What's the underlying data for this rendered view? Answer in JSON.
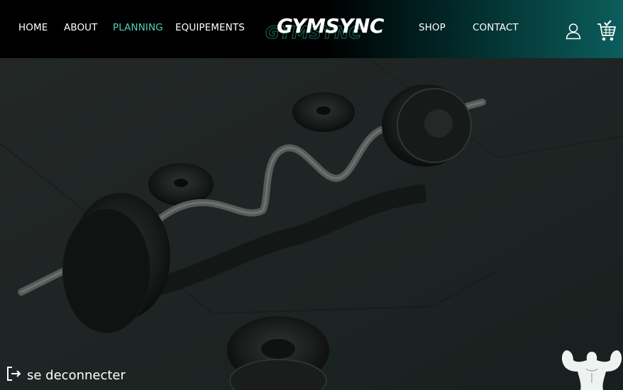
{
  "nav": {
    "left_links": [
      {
        "label": "HOME"
      },
      {
        "label": "ABOUT"
      },
      {
        "label": "PLANNING",
        "active": true
      },
      {
        "label": "EQUIPEMENTS"
      }
    ],
    "right_links": [
      {
        "label": "SHOP"
      },
      {
        "label": "CONTACT"
      }
    ],
    "logo": "GYMSYNC",
    "icons": [
      "user-icon",
      "shopping-cart-icon"
    ]
  },
  "footer": {
    "logout_label": "se deconnecter",
    "logout_icon": "logout-icon",
    "mascot_icon": "bodybuilder-icon"
  },
  "colors": {
    "accent": "#4fd1b4",
    "nav_bg": "#000000",
    "nav_gradient_end": "#0b5e5c"
  }
}
